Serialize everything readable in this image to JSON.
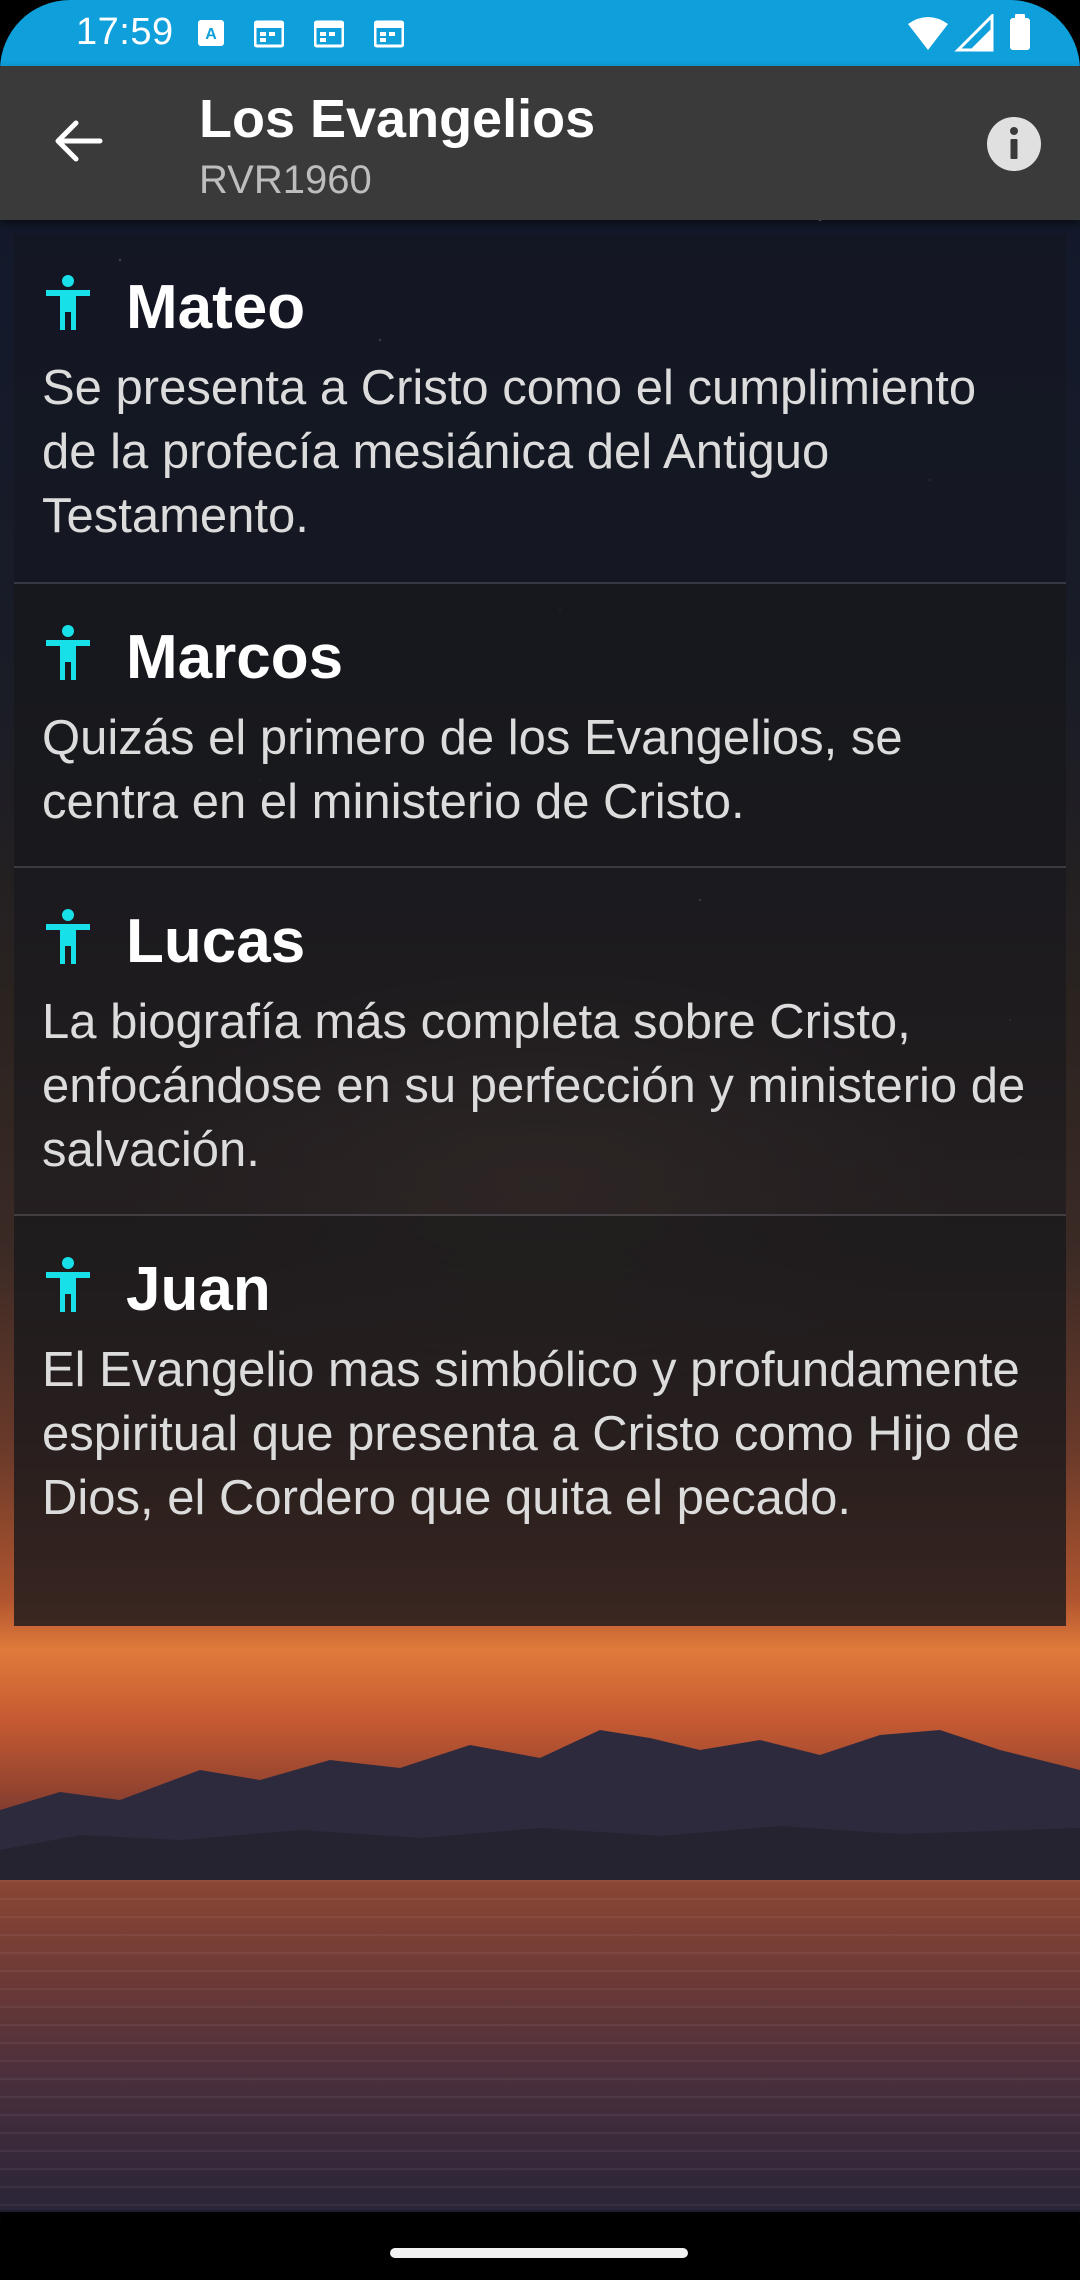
{
  "status_bar": {
    "time": "17:59",
    "notification_icons": [
      "text-icon",
      "calendar-icon",
      "calendar-icon",
      "calendar-icon"
    ],
    "system_icons": [
      "wifi-icon",
      "signal-icon",
      "battery-icon"
    ]
  },
  "app_bar": {
    "title": "Los Evangelios",
    "subtitle": "RVR1960",
    "accent_color": "#0f9fda"
  },
  "gospels": [
    {
      "name": "Mateo",
      "description": "Se presenta a Cristo como el cumplimiento de la profecía mesiánica del Antiguo Testamento."
    },
    {
      "name": "Marcos",
      "description": "Quizás el primero de los Evangelios, se centra en el ministerio de Cristo."
    },
    {
      "name": "Lucas",
      "description": "La biografía más completa sobre Cristo, enfocándose en su perfección y ministerio de salvación."
    },
    {
      "name": "Juan",
      "description": "El Evangelio mas simbólico y profundamente espiritual que presenta a Cristo como Hijo de Dios, el Cordero que quita el pecado."
    }
  ],
  "icon_color": "#18e0e8"
}
